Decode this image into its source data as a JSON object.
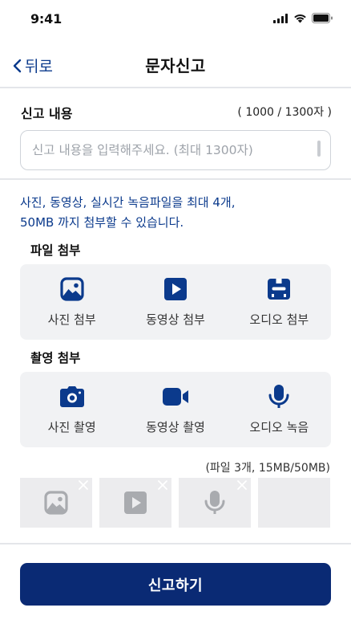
{
  "status_bar": {
    "time": "9:41"
  },
  "nav": {
    "back_label": "뒤로",
    "title": "문자신고"
  },
  "report": {
    "label": "신고 내용",
    "char_count": "( 1000 / 1300자 )",
    "placeholder": "신고 내용을 입력해주세요. (최대 1300자)"
  },
  "notice": {
    "line1": "사진, 동영상, 실시간 녹음파일을 최대 4개,",
    "line2": "50MB 까지 첨부할 수 있습니다."
  },
  "file_attach": {
    "label": "파일 첨부",
    "items": [
      {
        "label": "사진 첨부",
        "icon": "image-icon"
      },
      {
        "label": "동영상 첨부",
        "icon": "play-video-icon"
      },
      {
        "label": "오디오 첨부",
        "icon": "cassette-icon"
      }
    ]
  },
  "capture_attach": {
    "label": "촬영 첨부",
    "items": [
      {
        "label": "사진 촬영",
        "icon": "camera-icon"
      },
      {
        "label": "동영상 촬영",
        "icon": "video-camera-icon"
      },
      {
        "label": "오디오 녹음",
        "icon": "microphone-icon"
      }
    ]
  },
  "attachments": {
    "info": "(파일 3개, 15MB/50MB)",
    "items": [
      {
        "type": "image",
        "icon": "image-icon",
        "removable": true
      },
      {
        "type": "video",
        "icon": "play-video-icon",
        "removable": true
      },
      {
        "type": "audio",
        "icon": "microphone-icon",
        "removable": true
      },
      {
        "type": "empty",
        "icon": "",
        "removable": false
      }
    ]
  },
  "submit": {
    "label": "신고하기"
  },
  "colors": {
    "accent": "#0b3a8c",
    "button": "#0a2a74",
    "panel_bg": "#f1f2f4",
    "thumb_bg": "#ececee",
    "thumb_icon": "#a9abaf"
  }
}
